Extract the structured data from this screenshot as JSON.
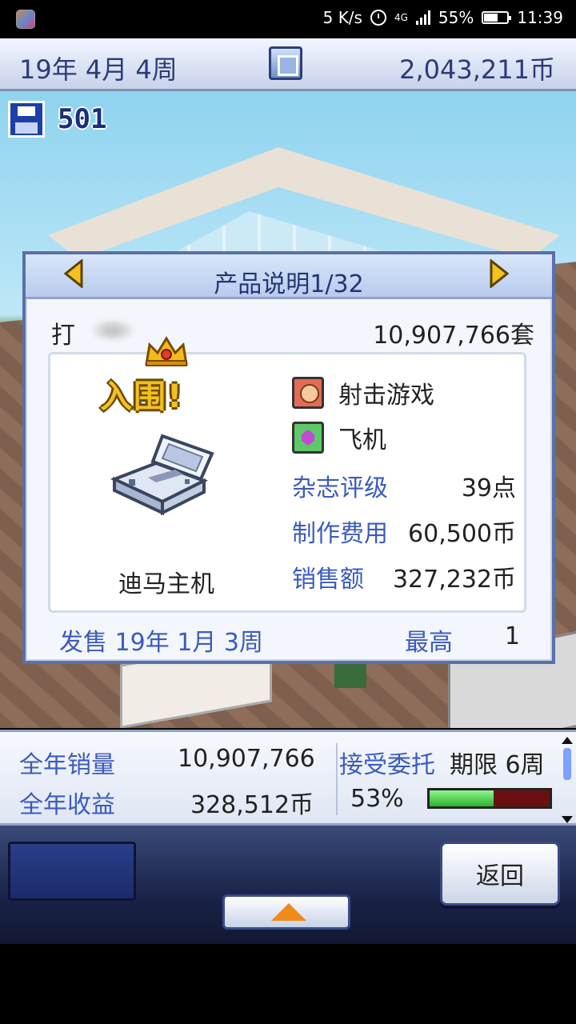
{
  "status_bar": {
    "speed": "5 K/s",
    "network": "4G",
    "battery_percent": "55%",
    "time": "11:39"
  },
  "header": {
    "date": "19年 4月 4周",
    "money": "2,043,211币"
  },
  "save": {
    "count": "501"
  },
  "dialog": {
    "title": "产品说明1/32",
    "game_name": "打",
    "units_sold": "10,907,766套",
    "award": "入围!",
    "platform": "迪马主机",
    "genre": "射击游戏",
    "theme": "飞机",
    "stats": [
      {
        "label": "杂志评级",
        "value": "39点"
      },
      {
        "label": "制作费用",
        "value": "60,500币"
      },
      {
        "label": "销售额",
        "value": "327,232币"
      }
    ],
    "release_date": "发售 19年 1月 3周",
    "best_rank_label": "最高",
    "best_rank_value": "1"
  },
  "stats_panel": {
    "annual_sales_label": "全年销量",
    "annual_sales_value": "10,907,766",
    "annual_revenue_label": "全年收益",
    "annual_revenue_value": "328,512币",
    "contract_label": "接受委托",
    "deadline": "期限 6周",
    "progress_text": "53%",
    "progress": 0.53
  },
  "controls": {
    "back_label": "返回"
  },
  "colors": {
    "accent_blue": "#3b5bbf",
    "dialog_border": "#5a70a8",
    "progress_fill": "#2db32d",
    "progress_bg": "#6b1010",
    "award_gold": "#f2c020"
  }
}
